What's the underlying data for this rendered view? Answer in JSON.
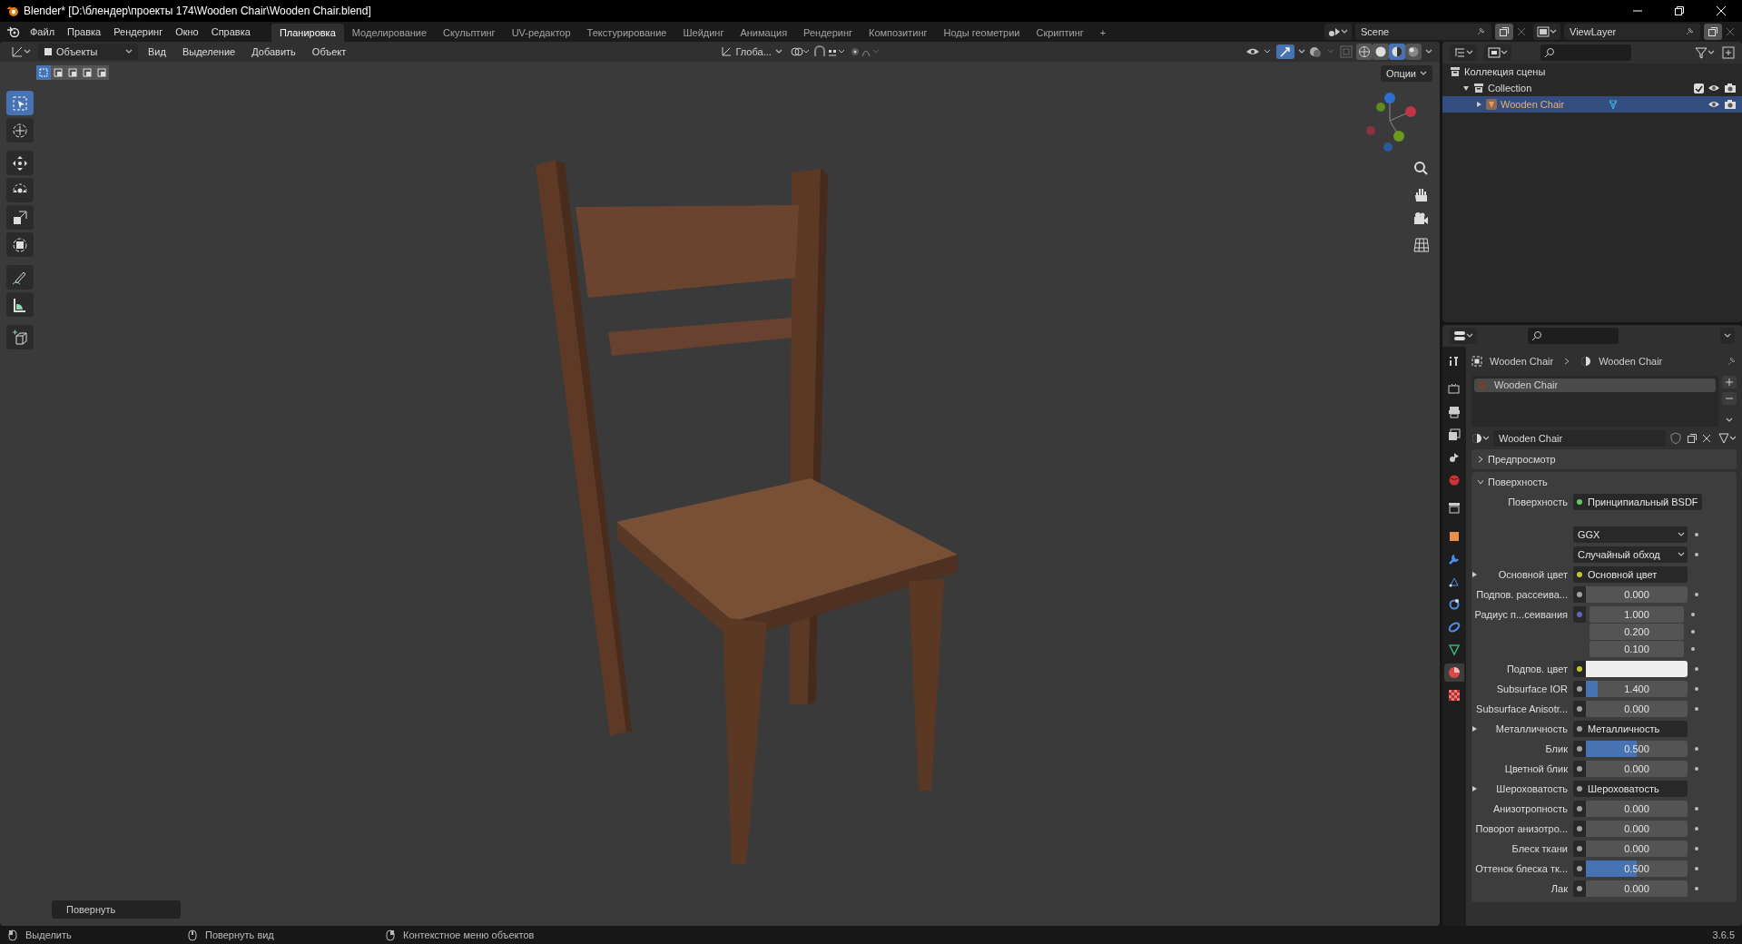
{
  "window": {
    "title": "Blender* [D:\\блендер\\проекты 174\\Wooden Chair\\Wooden Chair.blend]"
  },
  "menu": [
    "Файл",
    "Правка",
    "Рендеринг",
    "Окно",
    "Справка"
  ],
  "workspaces": [
    {
      "label": "Планировка",
      "selected": true
    },
    {
      "label": "Моделирование",
      "selected": false
    },
    {
      "label": "Скульптинг",
      "selected": false
    },
    {
      "label": "UV-редактор",
      "selected": false
    },
    {
      "label": "Текстурирование",
      "selected": false
    },
    {
      "label": "Шейдинг",
      "selected": false
    },
    {
      "label": "Анимация",
      "selected": false
    },
    {
      "label": "Рендеринг",
      "selected": false
    },
    {
      "label": "Композитинг",
      "selected": false
    },
    {
      "label": "Ноды геометрии",
      "selected": false
    },
    {
      "label": "Скриптинг",
      "selected": false
    }
  ],
  "add_workspace": "+",
  "scene": "Scene",
  "view_layer": "ViewLayer",
  "viewport": {
    "mode": "Объекты",
    "menus": [
      "Вид",
      "Выделение",
      "Добавить",
      "Объект"
    ],
    "orientation": "Глоба...",
    "options": "Опции",
    "shading": [
      {
        "kind": "wireframe",
        "selected": false
      },
      {
        "kind": "solid",
        "selected": false
      },
      {
        "kind": "material",
        "selected": true
      },
      {
        "kind": "rendered",
        "selected": false
      }
    ],
    "tools": [
      {
        "kind": "select",
        "selected": true
      },
      {
        "kind": "cursor",
        "selected": false
      },
      {
        "kind": "move",
        "selected": false
      },
      {
        "kind": "rotate",
        "selected": false
      },
      {
        "kind": "scale",
        "selected": false
      },
      {
        "kind": "transform",
        "selected": false
      },
      {
        "kind": "annotate",
        "selected": false
      },
      {
        "kind": "measure",
        "selected": false
      },
      {
        "kind": "add-cube",
        "selected": false
      }
    ],
    "operator_panel": "Повернуть"
  },
  "outliner": {
    "items": [
      {
        "label": "Коллекция сцены",
        "kind": "scene-collection",
        "children": [
          {
            "label": "Collection",
            "kind": "collection",
            "expanded": true,
            "checked": true,
            "children": [
              {
                "label": "Wooden Chair",
                "kind": "object",
                "expanded": false,
                "selected": true
              }
            ]
          }
        ]
      }
    ]
  },
  "properties": {
    "tabs": [
      {
        "kind": "tool",
        "selected": false
      },
      {
        "kind": "render",
        "selected": false
      },
      {
        "kind": "output",
        "selected": false
      },
      {
        "kind": "view-layer",
        "selected": false
      },
      {
        "kind": "scene",
        "selected": false
      },
      {
        "kind": "world",
        "selected": false
      },
      {
        "kind": "collection",
        "selected": false
      },
      {
        "kind": "object",
        "selected": false
      },
      {
        "kind": "modifier",
        "selected": false
      },
      {
        "kind": "particles",
        "selected": false
      },
      {
        "kind": "physics",
        "selected": false
      },
      {
        "kind": "constraints",
        "selected": false
      },
      {
        "kind": "data",
        "selected": false
      },
      {
        "kind": "material",
        "selected": true
      },
      {
        "kind": "texture",
        "selected": false
      }
    ],
    "breadcrumb": [
      "Wooden Chair",
      "Wooden Chair"
    ],
    "slots": [
      {
        "label": "Wooden Chair",
        "selected": true
      }
    ],
    "material": "Wooden Chair",
    "panels": [
      {
        "label": "Предпросмотр",
        "expanded": false
      },
      {
        "label": "Поверхность",
        "expanded": true
      }
    ],
    "rows": [
      {
        "kind": "link",
        "label": "Поверхность",
        "value": "Принципиальный BSDF",
        "color": "#63c763"
      },
      {
        "kind": "dropdown",
        "value": "GGX"
      },
      {
        "kind": "dropdown",
        "value": "Случайный обход"
      },
      {
        "kind": "link",
        "label": "Основной цвет",
        "value": "Основной цвет",
        "color": "#c7c729",
        "expandable": true
      },
      {
        "kind": "number",
        "label": "Подпов. рассеива...",
        "value": "0.000",
        "level": 0,
        "color": "#a1a1a1"
      },
      {
        "kind": "vector",
        "label": "Радиус п...сеивания",
        "values": [
          "1.000",
          "0.200",
          "0.100"
        ],
        "color": "#6363c7"
      },
      {
        "kind": "swatch",
        "label": "Подпов. цвет",
        "color": "#c7c729"
      },
      {
        "kind": "number",
        "label": "Subsurface IOR",
        "value": "1.400",
        "level": 0.12,
        "color": "#a1a1a1"
      },
      {
        "kind": "number",
        "label": "Subsurface Anisotr...",
        "value": "0.000",
        "level": 0,
        "color": "#a1a1a1"
      },
      {
        "kind": "link",
        "label": "Металличность",
        "value": "Металличность",
        "color": "#a1a1a1",
        "expandable": true
      },
      {
        "kind": "number",
        "label": "Блик",
        "value": "0.500",
        "level": 0.5,
        "color": "#a1a1a1"
      },
      {
        "kind": "number",
        "label": "Цветной блик",
        "value": "0.000",
        "level": 0,
        "color": "#a1a1a1"
      },
      {
        "kind": "link",
        "label": "Шероховатость",
        "value": "Шероховатость",
        "color": "#a1a1a1",
        "expandable": true
      },
      {
        "kind": "number",
        "label": "Анизотропность",
        "value": "0.000",
        "level": 0,
        "color": "#a1a1a1"
      },
      {
        "kind": "number",
        "label": "Поворот анизотро...",
        "value": "0.000",
        "level": 0,
        "color": "#a1a1a1"
      },
      {
        "kind": "number",
        "label": "Блеск ткани",
        "value": "0.000",
        "level": 0,
        "color": "#a1a1a1"
      },
      {
        "kind": "number",
        "label": "Оттенок блеска тк...",
        "value": "0.500",
        "level": 0.5,
        "color": "#a1a1a1"
      },
      {
        "kind": "number",
        "label": "Лак",
        "value": "0.000",
        "level": 0,
        "color": "#a1a1a1"
      }
    ]
  },
  "status_bar": {
    "hints": [
      "Выделить",
      "Повернуть вид",
      "Контекстное меню объектов"
    ],
    "version": "3.6.5"
  }
}
